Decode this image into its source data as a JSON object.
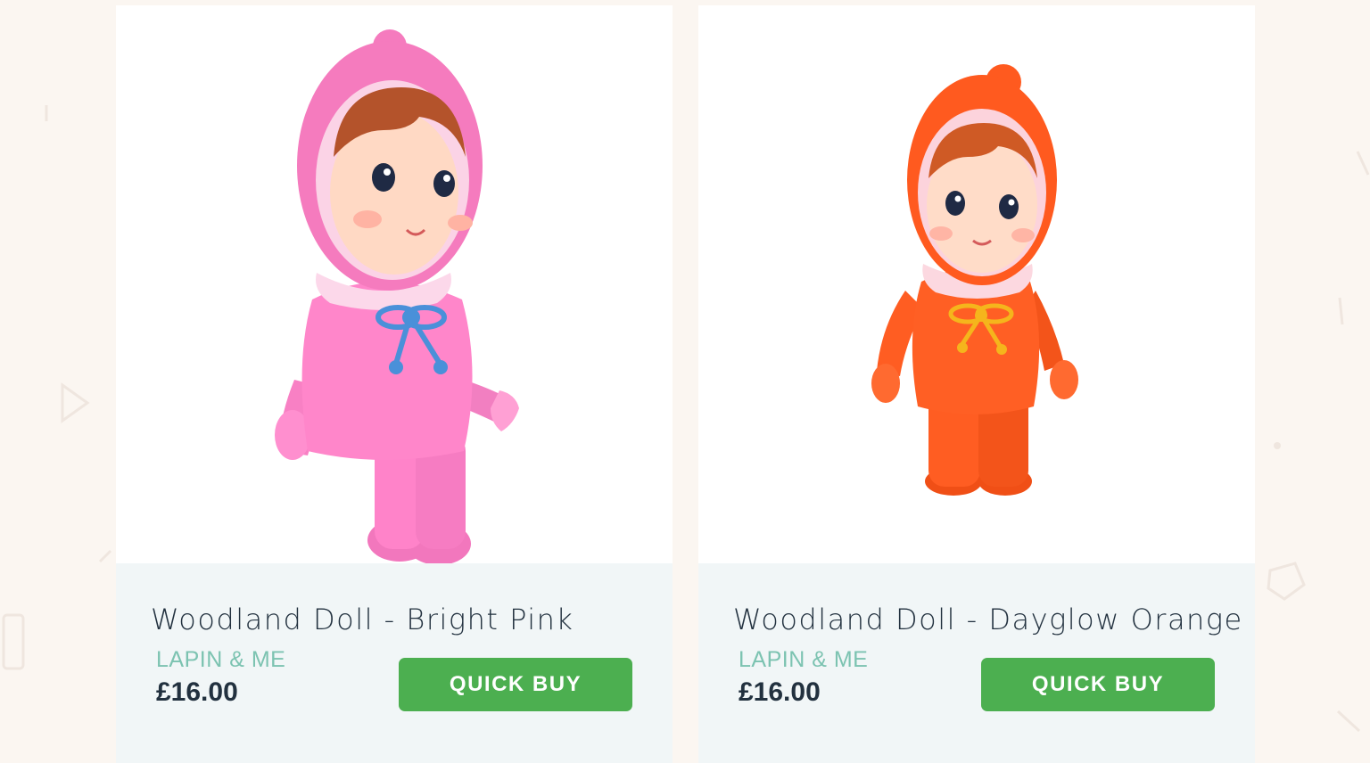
{
  "colors": {
    "page_background": "#fbf6f1",
    "card_info_background": "#f1f6f7",
    "title_text": "#22313f",
    "brand_text": "#7cc3b1",
    "button_background": "#4caf50",
    "button_text": "#ffffff"
  },
  "products": [
    {
      "title": "Woodland Doll - Bright Pink",
      "brand": "LAPIN & ME",
      "price": "£16.00",
      "button_label": "QUICK BUY",
      "image_icon": "pink-doll-image",
      "doll_color": "#ff7fc8"
    },
    {
      "title": "Woodland Doll - Dayglow Orange",
      "brand": "LAPIN & ME",
      "price": "£16.00",
      "button_label": "QUICK BUY",
      "image_icon": "orange-doll-image",
      "doll_color": "#ff5a1f"
    }
  ]
}
